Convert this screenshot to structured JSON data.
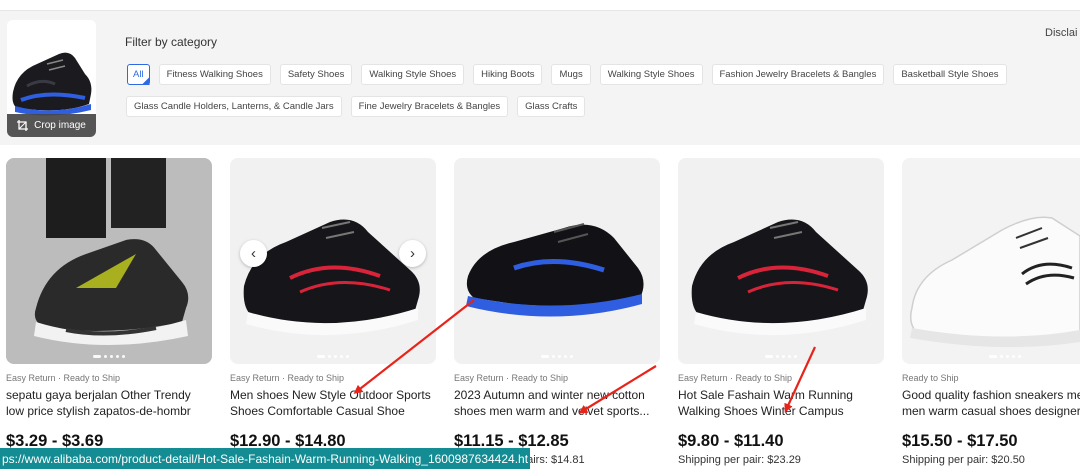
{
  "filter": {
    "title": "Filter by category",
    "disclaimer": "Disclai",
    "crop_label": "Crop image",
    "chips_row1": [
      {
        "label": "All",
        "active": true
      },
      {
        "label": "Fitness Walking Shoes"
      },
      {
        "label": "Safety Shoes"
      },
      {
        "label": "Walking Style Shoes"
      },
      {
        "label": "Hiking Boots"
      },
      {
        "label": "Mugs"
      },
      {
        "label": "Walking Style Shoes"
      },
      {
        "label": "Fashion Jewelry Bracelets & Bangles"
      },
      {
        "label": "Basketball Style Shoes"
      }
    ],
    "chips_row2": [
      {
        "label": "Glass Candle Holders, Lanterns, & Candle Jars"
      },
      {
        "label": "Fine Jewelry Bracelets & Bangles"
      },
      {
        "label": "Glass Crafts"
      }
    ]
  },
  "products": [
    {
      "badges": "Easy Return · Ready to Ship",
      "title": "sepatu gaya berjalan Other Trendy low price stylish zapatos-de-hombr tenis...",
      "price": "$3.29 - $3.69",
      "shipping": ""
    },
    {
      "badges": "Easy Return · Ready to Ship",
      "title": "Men shoes New Style Outdoor Sports Shoes Comfortable Casual Shoe",
      "price": "$12.90 - $14.80",
      "shipping": ""
    },
    {
      "badges": "Easy Return · Ready to Ship",
      "title": "2023 Autumn and winter new cotton shoes men warm and velvet sports...",
      "price": "$11.15 - $12.85",
      "shipping": "pairs: $14.81"
    },
    {
      "badges": "Easy Return · Ready to Ship",
      "title": "Hot Sale Fashain Warm Running Walking Shoes Winter Campus Shoes...",
      "price": "$9.80 - $11.40",
      "shipping": "Shipping per pair: $23.29"
    },
    {
      "badges": "Ready to Ship",
      "title": "Good quality fashion sneakers men men warm casual shoes designer...",
      "price": "$15.50 - $17.50",
      "shipping": "Shipping per pair: $20.50"
    }
  ],
  "carousel": {
    "prev": "‹",
    "next": "›"
  },
  "status_url": "ps://www.alibaba.com/product-detail/Hot-Sale-Fashain-Warm-Running-Walking_1600987634424.ht",
  "colors": {
    "accent": "#2d6ae3",
    "status_bar": "#148c93",
    "annotation_arrow": "#e8231a"
  }
}
